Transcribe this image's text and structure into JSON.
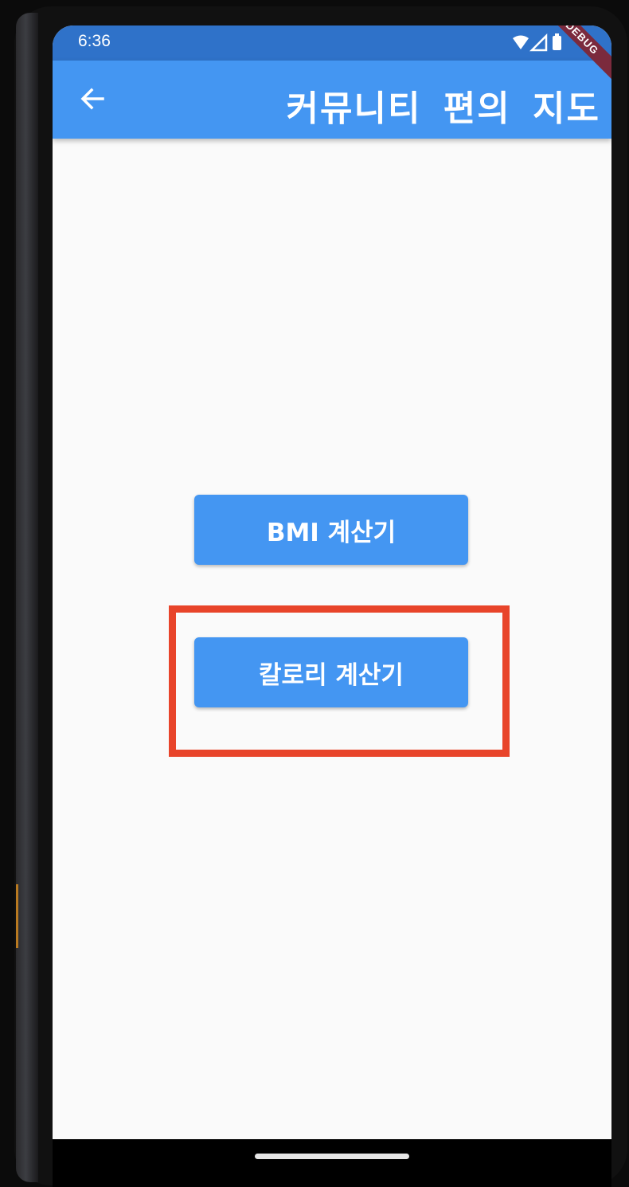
{
  "status_bar": {
    "time": "6:36",
    "icons": [
      "wifi-icon",
      "signal-icon",
      "battery-icon"
    ]
  },
  "debug_banner": {
    "label": "DEBUG"
  },
  "app_bar": {
    "back_icon": "arrow-left-icon",
    "title": "커뮤니티 편의 지도"
  },
  "main": {
    "buttons": [
      {
        "label": "BMI 계산기"
      },
      {
        "label": "칼로리 계산기"
      }
    ]
  },
  "colors": {
    "app_bar": "#4496f2",
    "status_bar": "#2f72c9",
    "button": "#4496f2",
    "highlight": "#e8442a",
    "background": "#fafafa",
    "debug_banner": "#7b2a3d"
  }
}
